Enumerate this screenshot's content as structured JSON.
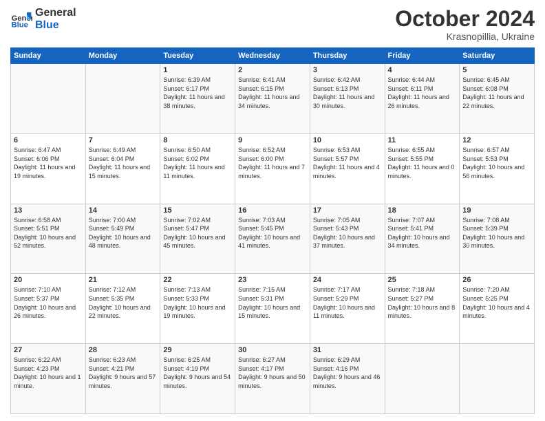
{
  "header": {
    "logo_line1": "General",
    "logo_line2": "Blue",
    "month": "October 2024",
    "location": "Krasnopillia, Ukraine"
  },
  "weekdays": [
    "Sunday",
    "Monday",
    "Tuesday",
    "Wednesday",
    "Thursday",
    "Friday",
    "Saturday"
  ],
  "weeks": [
    [
      {
        "day": "",
        "content": ""
      },
      {
        "day": "",
        "content": ""
      },
      {
        "day": "1",
        "content": "Sunrise: 6:39 AM\nSunset: 6:17 PM\nDaylight: 11 hours and 38 minutes."
      },
      {
        "day": "2",
        "content": "Sunrise: 6:41 AM\nSunset: 6:15 PM\nDaylight: 11 hours and 34 minutes."
      },
      {
        "day": "3",
        "content": "Sunrise: 6:42 AM\nSunset: 6:13 PM\nDaylight: 11 hours and 30 minutes."
      },
      {
        "day": "4",
        "content": "Sunrise: 6:44 AM\nSunset: 6:11 PM\nDaylight: 11 hours and 26 minutes."
      },
      {
        "day": "5",
        "content": "Sunrise: 6:45 AM\nSunset: 6:08 PM\nDaylight: 11 hours and 22 minutes."
      }
    ],
    [
      {
        "day": "6",
        "content": "Sunrise: 6:47 AM\nSunset: 6:06 PM\nDaylight: 11 hours and 19 minutes."
      },
      {
        "day": "7",
        "content": "Sunrise: 6:49 AM\nSunset: 6:04 PM\nDaylight: 11 hours and 15 minutes."
      },
      {
        "day": "8",
        "content": "Sunrise: 6:50 AM\nSunset: 6:02 PM\nDaylight: 11 hours and 11 minutes."
      },
      {
        "day": "9",
        "content": "Sunrise: 6:52 AM\nSunset: 6:00 PM\nDaylight: 11 hours and 7 minutes."
      },
      {
        "day": "10",
        "content": "Sunrise: 6:53 AM\nSunset: 5:57 PM\nDaylight: 11 hours and 4 minutes."
      },
      {
        "day": "11",
        "content": "Sunrise: 6:55 AM\nSunset: 5:55 PM\nDaylight: 11 hours and 0 minutes."
      },
      {
        "day": "12",
        "content": "Sunrise: 6:57 AM\nSunset: 5:53 PM\nDaylight: 10 hours and 56 minutes."
      }
    ],
    [
      {
        "day": "13",
        "content": "Sunrise: 6:58 AM\nSunset: 5:51 PM\nDaylight: 10 hours and 52 minutes."
      },
      {
        "day": "14",
        "content": "Sunrise: 7:00 AM\nSunset: 5:49 PM\nDaylight: 10 hours and 48 minutes."
      },
      {
        "day": "15",
        "content": "Sunrise: 7:02 AM\nSunset: 5:47 PM\nDaylight: 10 hours and 45 minutes."
      },
      {
        "day": "16",
        "content": "Sunrise: 7:03 AM\nSunset: 5:45 PM\nDaylight: 10 hours and 41 minutes."
      },
      {
        "day": "17",
        "content": "Sunrise: 7:05 AM\nSunset: 5:43 PM\nDaylight: 10 hours and 37 minutes."
      },
      {
        "day": "18",
        "content": "Sunrise: 7:07 AM\nSunset: 5:41 PM\nDaylight: 10 hours and 34 minutes."
      },
      {
        "day": "19",
        "content": "Sunrise: 7:08 AM\nSunset: 5:39 PM\nDaylight: 10 hours and 30 minutes."
      }
    ],
    [
      {
        "day": "20",
        "content": "Sunrise: 7:10 AM\nSunset: 5:37 PM\nDaylight: 10 hours and 26 minutes."
      },
      {
        "day": "21",
        "content": "Sunrise: 7:12 AM\nSunset: 5:35 PM\nDaylight: 10 hours and 22 minutes."
      },
      {
        "day": "22",
        "content": "Sunrise: 7:13 AM\nSunset: 5:33 PM\nDaylight: 10 hours and 19 minutes."
      },
      {
        "day": "23",
        "content": "Sunrise: 7:15 AM\nSunset: 5:31 PM\nDaylight: 10 hours and 15 minutes."
      },
      {
        "day": "24",
        "content": "Sunrise: 7:17 AM\nSunset: 5:29 PM\nDaylight: 10 hours and 11 minutes."
      },
      {
        "day": "25",
        "content": "Sunrise: 7:18 AM\nSunset: 5:27 PM\nDaylight: 10 hours and 8 minutes."
      },
      {
        "day": "26",
        "content": "Sunrise: 7:20 AM\nSunset: 5:25 PM\nDaylight: 10 hours and 4 minutes."
      }
    ],
    [
      {
        "day": "27",
        "content": "Sunrise: 6:22 AM\nSunset: 4:23 PM\nDaylight: 10 hours and 1 minute."
      },
      {
        "day": "28",
        "content": "Sunrise: 6:23 AM\nSunset: 4:21 PM\nDaylight: 9 hours and 57 minutes."
      },
      {
        "day": "29",
        "content": "Sunrise: 6:25 AM\nSunset: 4:19 PM\nDaylight: 9 hours and 54 minutes."
      },
      {
        "day": "30",
        "content": "Sunrise: 6:27 AM\nSunset: 4:17 PM\nDaylight: 9 hours and 50 minutes."
      },
      {
        "day": "31",
        "content": "Sunrise: 6:29 AM\nSunset: 4:16 PM\nDaylight: 9 hours and 46 minutes."
      },
      {
        "day": "",
        "content": ""
      },
      {
        "day": "",
        "content": ""
      }
    ]
  ]
}
